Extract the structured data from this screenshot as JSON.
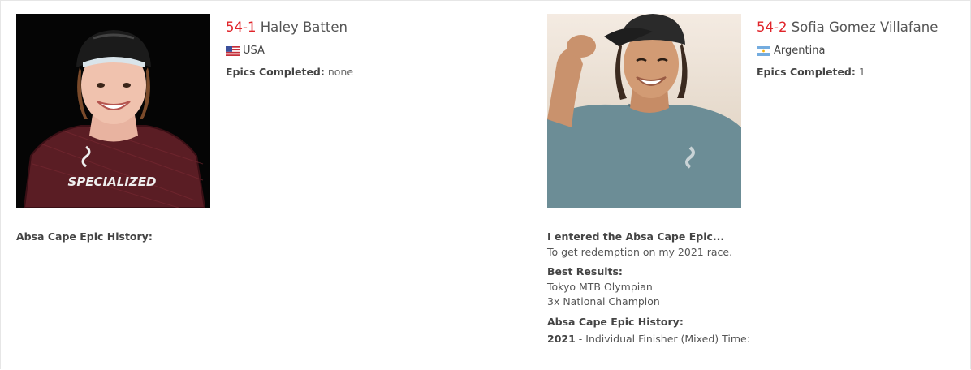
{
  "riders": [
    {
      "number": "54-1",
      "name": "Haley Batten",
      "country": "USA",
      "flag": "us-flag",
      "epics_label": "Epics Completed:",
      "epics_value": "none",
      "history_heading": "Absa Cape Epic History:",
      "jersey_text": "SPECIALIZED"
    },
    {
      "number": "54-2",
      "name": "Sofia Gomez Villafane",
      "country": "Argentina",
      "flag": "argentina-flag",
      "epics_label": "Epics Completed:",
      "epics_value": "1",
      "entered_heading": "I entered the Absa Cape Epic...",
      "entered_text": "To get redemption on my 2021 race.",
      "best_heading": "Best Results:",
      "best_results": [
        "Tokyo MTB Olympian",
        "3x National Champion"
      ],
      "history_heading": "Absa Cape Epic History:",
      "history": [
        {
          "year": "2021",
          "text": " - Individual Finisher (Mixed) Time:"
        }
      ]
    }
  ],
  "colors": {
    "number_red": "#e0242a",
    "text": "#555555"
  }
}
